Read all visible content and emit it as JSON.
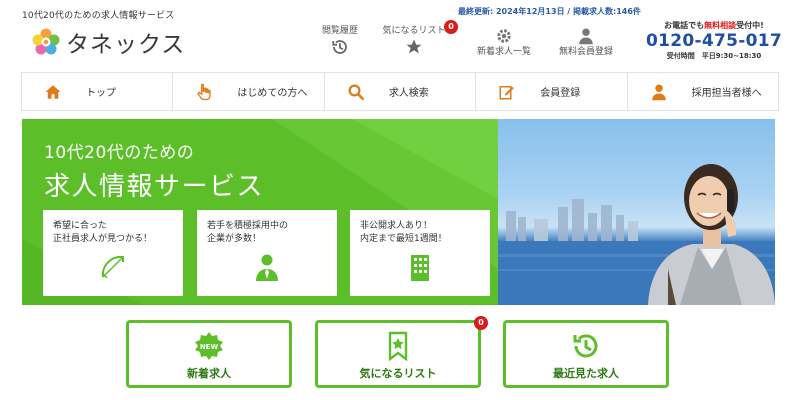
{
  "header": {
    "tagline": "10代20代のための求人情報サービス",
    "logo_text": "タネックス",
    "update_line": "最終更新: 2024年12月13日 / 掲載求人数:146件",
    "icons": [
      {
        "label": "閲覧履歴",
        "icon": "history-icon"
      },
      {
        "label": "気になるリスト",
        "icon": "star-icon",
        "badge": "0"
      },
      {
        "label": "新着求人一覧",
        "icon": "gear-icon"
      },
      {
        "label": "無料会員登録",
        "icon": "person-icon"
      }
    ],
    "phone": {
      "caption_prefix": "お電話でも",
      "caption_highlight": "無料相談",
      "caption_suffix": "受付中!",
      "number": "0120-475-017",
      "hours": "受付時間　平日9:30~18:30"
    }
  },
  "nav": {
    "items": [
      {
        "label": "トップ",
        "icon": "home-icon"
      },
      {
        "label": "はじめての方へ",
        "icon": "pointing-hand-icon"
      },
      {
        "label": "求人検索",
        "icon": "search-icon"
      },
      {
        "label": "会員登録",
        "icon": "edit-icon"
      },
      {
        "label": "採用担当者様へ",
        "icon": "person-icon"
      }
    ]
  },
  "hero": {
    "title_line1": "10代20代のための",
    "title_line2": "求人情報サービス",
    "features": [
      {
        "line1": "希望に合った",
        "line2": "正社員求人が見つかる！",
        "icon": "target-bow-icon"
      },
      {
        "line1": "若手を積極採用中の",
        "line2": "企業が多数！",
        "icon": "businessman-icon"
      },
      {
        "line1": "非公開求人あり！",
        "line2": "内定まで最短1週間！",
        "icon": "building-icon"
      }
    ]
  },
  "quick_buttons": [
    {
      "label": "新着求人",
      "icon": "new-badge-icon",
      "badge_text": "NEW"
    },
    {
      "label": "気になるリスト",
      "icon": "bookmark-star-icon",
      "badge": "0"
    },
    {
      "label": "最近見た求人",
      "icon": "history-icon"
    }
  ],
  "colors": {
    "brand_green": "#5cbf2a",
    "dark_green": "#2f7a16",
    "phone_blue": "#1f4fa0",
    "badge_red": "#d81b1b",
    "nav_icon_orange": "#e07a16"
  }
}
